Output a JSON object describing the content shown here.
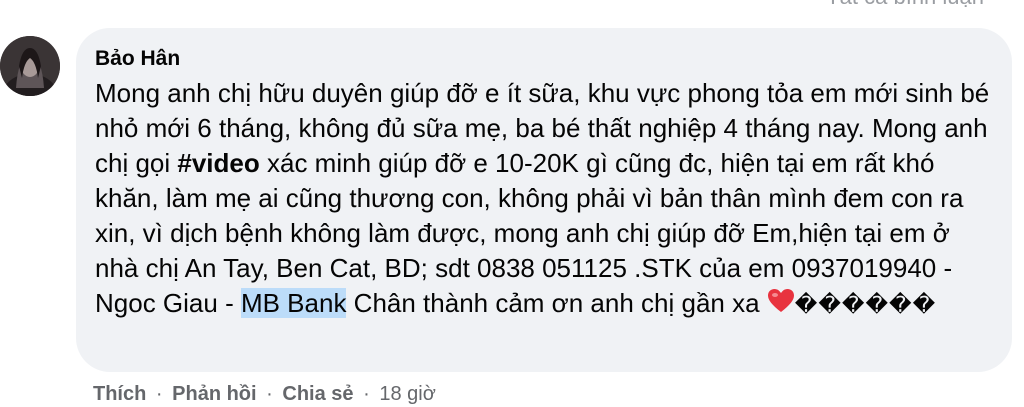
{
  "header": {
    "all_comments_label": "Tất cả bình luận"
  },
  "comment": {
    "author": "Bảo Hân",
    "text_before_tag": "Mong anh chị hữu duyên giúp đỡ e ít sữa, khu vực phong tỏa em mới sinh bé nhỏ mới 6 tháng, không đủ sữa mẹ, ba bé thất nghiệp 4 tháng nay. Mong anh chị gọi ",
    "hashtag": "#video",
    "text_after_tag": " xác minh giúp đỡ e 10-20K gì cũng đc, hiện tại em rất khó khăn, làm mẹ ai cũng thương con, không phải vì bản thân mình đem con ra xin, vì dịch bệnh không làm được, mong anh chị giúp đỡ Em,hiện tại em ở nhà chị An Tay, Ben Cat, BD; sdt 0838 051125 .STK của em 0937019940 - Ngoc Giau - ",
    "highlighted": "MB Bank",
    "text_end": " Chân thành cảm ơn anh chị gần xa ",
    "emoji": "heart-emoji",
    "unknown_glyphs": "������"
  },
  "actions": {
    "like": "Thích",
    "reply": "Phản hồi",
    "share": "Chia sẻ",
    "separator": "·",
    "time": "18 giờ"
  },
  "colors": {
    "bubble": "#f0f2f5",
    "text": "#050505",
    "meta": "#65676b",
    "highlight": "#bcdcf9",
    "heart": "#e8333f"
  }
}
